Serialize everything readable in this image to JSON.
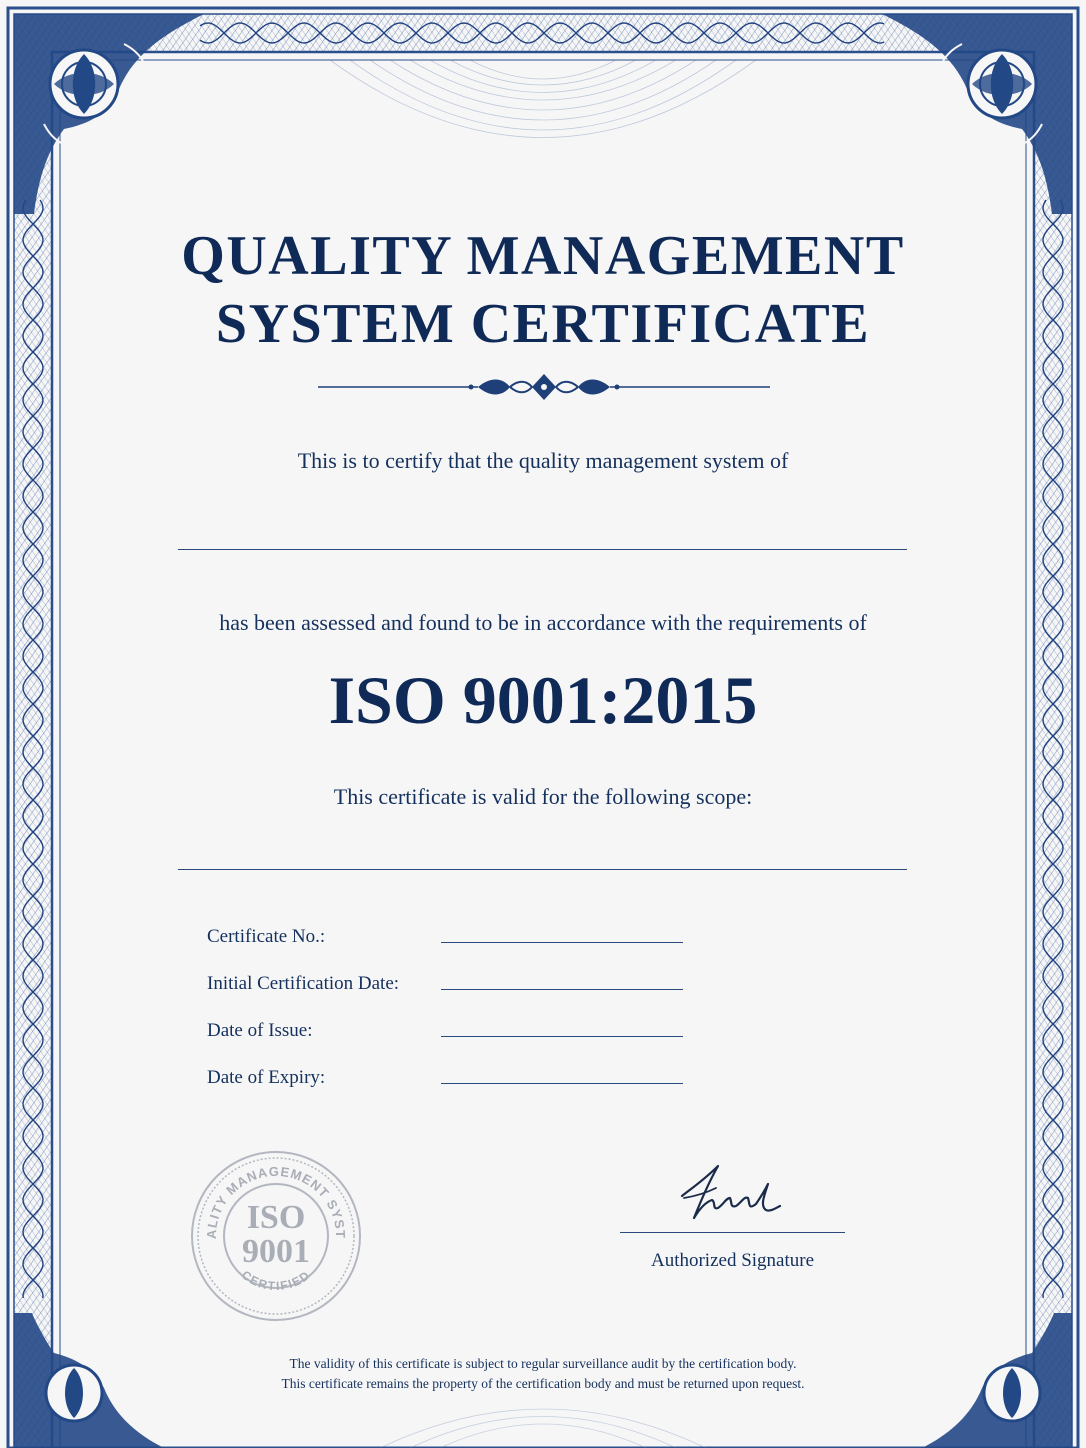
{
  "certificate": {
    "title_line1": "QUALITY MANAGEMENT",
    "title_line2": "SYSTEM CERTIFICATE",
    "certify_text": "This is to certify that the quality management system of",
    "assessed_text": "has been assessed and found to be in accordance with the requirements of",
    "standard": "ISO 9001:2015",
    "scope_text": "This certificate is valid for the following scope:",
    "fields": [
      {
        "label": "Certificate No.:",
        "value": ""
      },
      {
        "label": "Initial Certification Date:",
        "value": ""
      },
      {
        "label": "Date of Issue:",
        "value": ""
      },
      {
        "label": "Date of Expiry:",
        "value": ""
      }
    ],
    "signature_label": "Authorized Signature",
    "seal": {
      "top_text": "QUALITY MANAGEMENT SYSTEM",
      "center_line1": "ISO",
      "center_line2": "9001",
      "bottom_text": "CERTIFIED"
    },
    "footer_line1": "The validity of this certificate is subject to regular surveillance audit by the certification body.",
    "footer_line2": "This certificate remains the property of the certification body and must be returned upon request."
  },
  "colors": {
    "ink": "#0f2a57",
    "border": "#2b4f8c",
    "paper": "#f6f6f7",
    "seal": "#a9adb5"
  },
  "icons": {
    "corner": "floral-corner-ornament",
    "divider": "scroll-divider-ornament",
    "seal": "iso-seal-stamp",
    "signature": "handwritten-signature"
  }
}
